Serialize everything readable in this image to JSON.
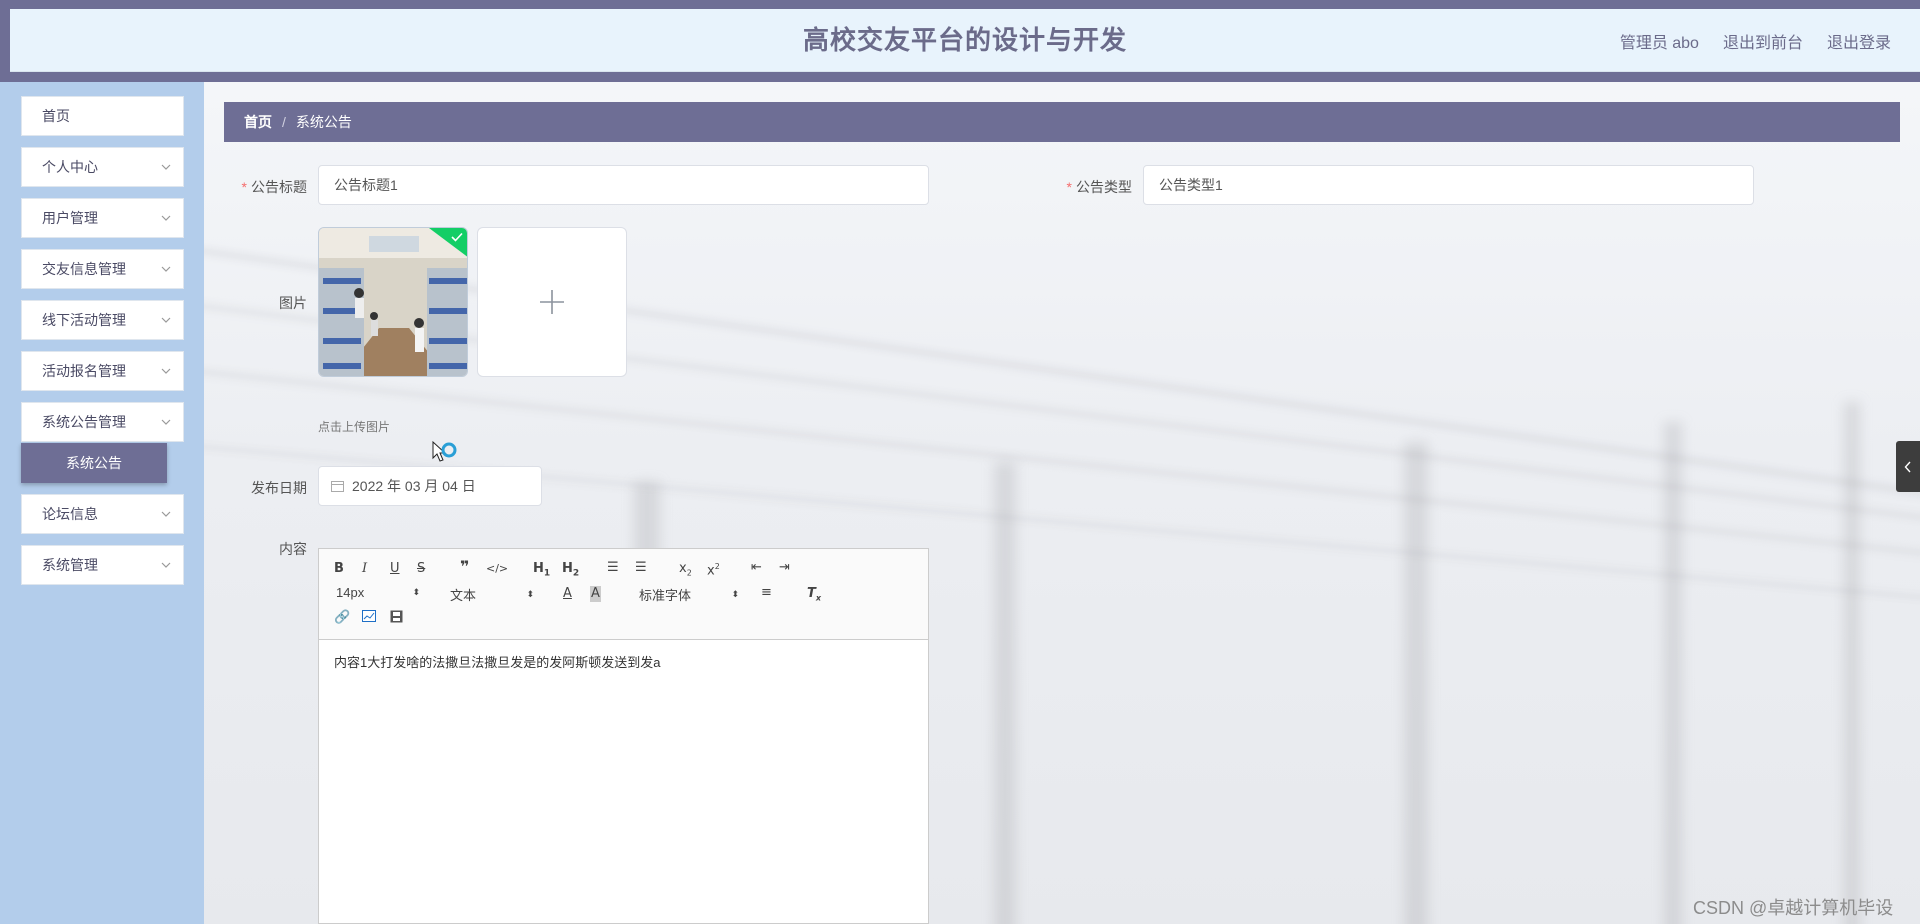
{
  "header": {
    "title": "高校交友平台的设计与开发",
    "admin_label": "管理员 abo",
    "to_front": "退出到前台",
    "logout": "退出登录"
  },
  "sidebar": {
    "items": [
      {
        "label": "首页",
        "has_chevron": false
      },
      {
        "label": "个人中心",
        "has_chevron": true
      },
      {
        "label": "用户管理",
        "has_chevron": true
      },
      {
        "label": "交友信息管理",
        "has_chevron": true
      },
      {
        "label": "线下活动管理",
        "has_chevron": true
      },
      {
        "label": "活动报名管理",
        "has_chevron": true
      },
      {
        "label": "系统公告管理",
        "has_chevron": true
      },
      {
        "label": "论坛信息",
        "has_chevron": true
      },
      {
        "label": "系统管理",
        "has_chevron": true
      }
    ],
    "active_sub": "系统公告"
  },
  "breadcrumb": {
    "home": "首页",
    "separator": "/",
    "current": "系统公告"
  },
  "form": {
    "title_label": "公告标题",
    "title_value": "公告标题1",
    "type_label": "公告类型",
    "type_value": "公告类型1",
    "image_label": "图片",
    "upload_tip": "点击上传图片",
    "date_label": "发布日期",
    "date_value": "2022 年 03 月 04 日",
    "content_label": "内容"
  },
  "editor": {
    "font_size": "14px",
    "header_select": "文本",
    "font_family": "标准字体",
    "content": "内容1大打发啥的法撒旦法撒旦发是的发阿斯顿发送到发a"
  },
  "watermark": "CSDN @卓越计算机毕设",
  "colors": {
    "header_bg": "#6e6e95",
    "header_inner": "#e8f3fc",
    "sidebar_bg": "#b3cdeb",
    "accent": "#6e6e95",
    "required": "#f56c6c",
    "check_badge": "#13ce66"
  }
}
